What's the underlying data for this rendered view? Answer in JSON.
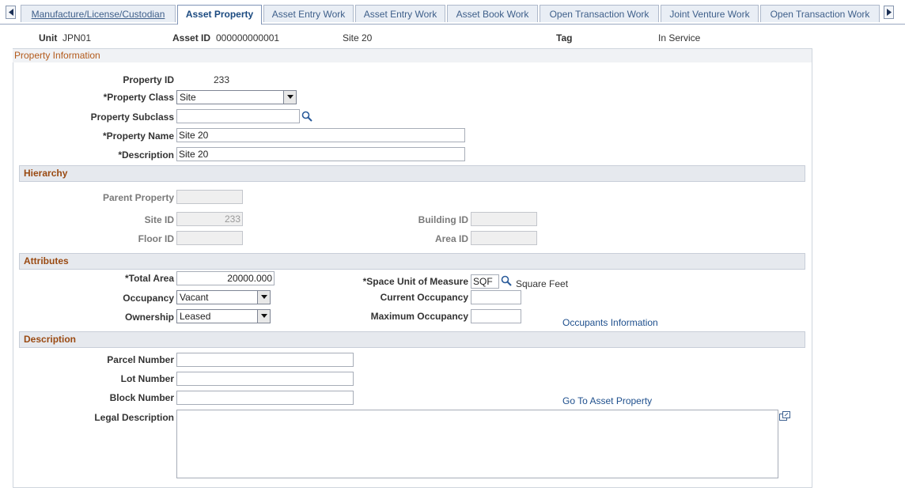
{
  "tabs": [
    {
      "label": "Manufacture/License/Custodian",
      "underline_first": true
    },
    {
      "label": "Asset Property",
      "active": true
    },
    {
      "label": "Asset Entry Work"
    },
    {
      "label": "Asset Entry Work"
    },
    {
      "label": "Asset Book Work"
    },
    {
      "label": "Open Transaction Work"
    },
    {
      "label": "Joint Venture Work"
    },
    {
      "label": "Open Transaction Work"
    }
  ],
  "header": {
    "unit_label": "Unit",
    "unit_value": "JPN01",
    "asset_id_label": "Asset ID",
    "asset_id_value": "000000000001",
    "asset_desc": "Site 20",
    "tag_label": "Tag",
    "status": "In Service"
  },
  "property_info": {
    "title": "Property Information",
    "property_id_label": "Property ID",
    "property_id_value": "233",
    "property_class_label": "*Property Class",
    "property_class_value": "Site",
    "property_subclass_label": "Property Subclass",
    "property_subclass_value": "",
    "property_name_label": "*Property Name",
    "property_name_value": "Site 20",
    "description_label": "*Description",
    "description_value": "Site 20"
  },
  "hierarchy": {
    "title": "Hierarchy",
    "parent_property_label": "Parent Property",
    "parent_property_value": "",
    "site_id_label": "Site ID",
    "site_id_value": "233",
    "floor_id_label": "Floor ID",
    "floor_id_value": "",
    "building_id_label": "Building ID",
    "building_id_value": "",
    "area_id_label": "Area ID",
    "area_id_value": ""
  },
  "attributes": {
    "title": "Attributes",
    "total_area_label": "*Total Area",
    "total_area_value": "20000.000",
    "occupancy_label": "Occupancy",
    "occupancy_value": "Vacant",
    "ownership_label": "Ownership",
    "ownership_value": "Leased",
    "space_uom_label": "*Space Unit of Measure",
    "space_uom_value": "SQF",
    "space_uom_desc": "Square Feet",
    "current_occupancy_label": "Current Occupancy",
    "current_occupancy_value": "",
    "max_occupancy_label": "Maximum Occupancy",
    "max_occupancy_value": "",
    "occupants_link": "Occupants Information"
  },
  "description_section": {
    "title": "Description",
    "parcel_label": "Parcel Number",
    "parcel_value": "",
    "lot_label": "Lot Number",
    "lot_value": "",
    "block_label": "Block Number",
    "block_value": "",
    "legal_label": "Legal Description",
    "legal_value": "",
    "go_to_link": "Go To Asset Property"
  }
}
